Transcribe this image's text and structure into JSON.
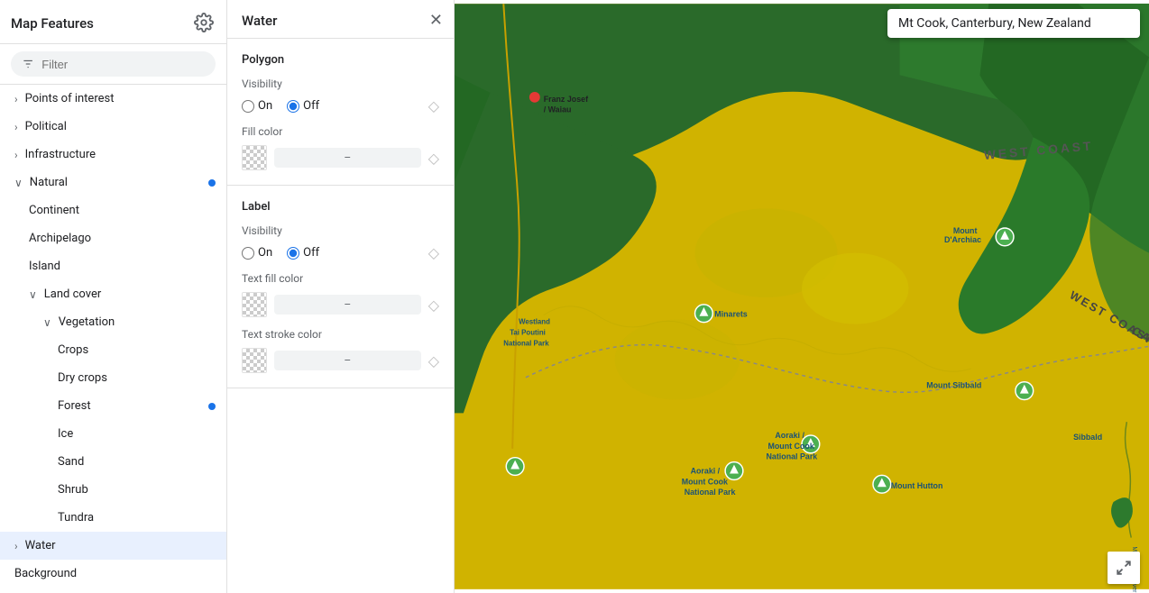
{
  "sidebar": {
    "title": "Map Features",
    "filter_placeholder": "Filter",
    "items": [
      {
        "id": "points-of-interest",
        "label": "Points of interest",
        "level": 0,
        "expandable": true,
        "expanded": false,
        "hasDot": false
      },
      {
        "id": "political",
        "label": "Political",
        "level": 0,
        "expandable": true,
        "expanded": false,
        "hasDot": false
      },
      {
        "id": "infrastructure",
        "label": "Infrastructure",
        "level": 0,
        "expandable": true,
        "expanded": false,
        "hasDot": false
      },
      {
        "id": "natural",
        "label": "Natural",
        "level": 0,
        "expandable": true,
        "expanded": true,
        "hasDot": true
      },
      {
        "id": "continent",
        "label": "Continent",
        "level": 1,
        "expandable": false,
        "expanded": false,
        "hasDot": false
      },
      {
        "id": "archipelago",
        "label": "Archipelago",
        "level": 1,
        "expandable": false,
        "expanded": false,
        "hasDot": false
      },
      {
        "id": "island",
        "label": "Island",
        "level": 1,
        "expandable": false,
        "expanded": false,
        "hasDot": false
      },
      {
        "id": "land-cover",
        "label": "Land cover",
        "level": 1,
        "expandable": true,
        "expanded": true,
        "hasDot": false
      },
      {
        "id": "vegetation",
        "label": "Vegetation",
        "level": 2,
        "expandable": true,
        "expanded": true,
        "hasDot": false
      },
      {
        "id": "crops",
        "label": "Crops",
        "level": 3,
        "expandable": false,
        "expanded": false,
        "hasDot": false
      },
      {
        "id": "dry-crops",
        "label": "Dry crops",
        "level": 3,
        "expandable": false,
        "expanded": false,
        "hasDot": false
      },
      {
        "id": "forest",
        "label": "Forest",
        "level": 3,
        "expandable": false,
        "expanded": false,
        "hasDot": true
      },
      {
        "id": "ice",
        "label": "Ice",
        "level": 3,
        "expandable": false,
        "expanded": false,
        "hasDot": false
      },
      {
        "id": "sand",
        "label": "Sand",
        "level": 3,
        "expandable": false,
        "expanded": false,
        "hasDot": false
      },
      {
        "id": "shrub",
        "label": "Shrub",
        "level": 3,
        "expandable": false,
        "expanded": false,
        "hasDot": false
      },
      {
        "id": "tundra",
        "label": "Tundra",
        "level": 3,
        "expandable": false,
        "expanded": false,
        "hasDot": false
      },
      {
        "id": "water",
        "label": "Water",
        "level": 0,
        "expandable": true,
        "expanded": false,
        "hasDot": false,
        "active": true
      },
      {
        "id": "background",
        "label": "Background",
        "level": 0,
        "expandable": false,
        "expanded": false,
        "hasDot": false
      }
    ]
  },
  "panel": {
    "title": "Water",
    "polygon_section": {
      "title": "Polygon",
      "visibility": {
        "label": "Visibility",
        "on_label": "On",
        "off_label": "Off",
        "selected": "Off"
      },
      "fill_color": {
        "label": "Fill color",
        "value": "–"
      }
    },
    "label_section": {
      "title": "Label",
      "visibility": {
        "label": "Visibility",
        "on_label": "On",
        "off_label": "Off",
        "selected": "Off"
      },
      "text_fill_color": {
        "label": "Text fill color",
        "value": "–"
      },
      "text_stroke_color": {
        "label": "Text stroke color",
        "value": "–"
      }
    }
  },
  "map": {
    "search_value": "Mt Cook, Canterbury, New Zealand",
    "colors": {
      "forest": "#2d6a2d",
      "grassland": "#c8b400",
      "border": "#b8a000",
      "label_color": "#5f6368"
    }
  },
  "icons": {
    "gear": "⚙",
    "filter": "≡",
    "close": "✕",
    "expand_right": "›",
    "expand_down": "∨",
    "diamond": "◇",
    "fullscreen": "⤢"
  }
}
